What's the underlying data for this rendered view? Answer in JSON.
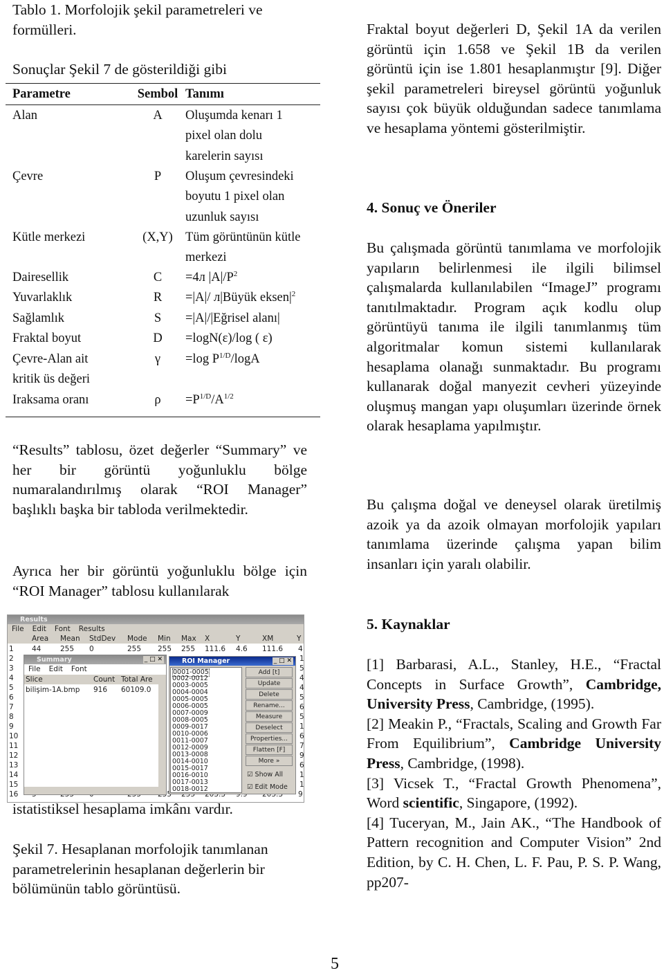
{
  "left": {
    "table_caption": [
      "Tablo 1. Morfolojik şekil parametreleri ve",
      "formülleri."
    ],
    "intro_line": "Sonuçlar Şekil 7 de gösterildiği gibi",
    "table": {
      "headers": [
        "Parametre",
        "Sembol",
        "Tanımı"
      ],
      "rows": [
        {
          "param": "Alan",
          "symbol": "A",
          "definition": [
            "Oluşumda kenarı 1",
            "pixel olan dolu",
            "karelerin sayısı"
          ]
        },
        {
          "param": "Çevre",
          "symbol": "P",
          "definition": [
            "Oluşum çevresindeki",
            "boyutu 1 pixel olan",
            "uzunluk sayısı"
          ]
        },
        {
          "param": "Kütle merkezi",
          "symbol": "(X,Y)",
          "definition": [
            "Tüm görüntünün kütle",
            "merkezi"
          ]
        },
        {
          "param": "Dairesellik",
          "symbol": "C",
          "formula": "=4л |A|/P",
          "sup": "2"
        },
        {
          "param": "Yuvarlaklık",
          "symbol": "R",
          "formula": "=|A|/ л|Büyük eksen|",
          "sup": "2"
        },
        {
          "param": "Sağlamlık",
          "symbol": "S",
          "formula": "=|A|/|Eğrisel alanı|"
        },
        {
          "param": "Fraktal boyut",
          "symbol": "D",
          "formula": "=logN(ε)/log ( ε)"
        },
        {
          "param": "Çevre-Alan ait",
          "param2": "kritik üs değeri",
          "symbol": "γ",
          "formula": "=log P",
          "sup": "1/D",
          "formula_tail": "/logA"
        },
        {
          "param": "Iraksama oranı",
          "symbol": "ρ",
          "formula": "=P",
          "sup": "1/D",
          "formula_mid": "/A",
          "sup2": "1/2"
        }
      ]
    },
    "para1": "“Results” tablosu, özet değerler “Summary” ve her bir görüntü yoğunluklu bölge numaralandırılmış olarak “ROI Manager” başlıklı başka bir tabloda verilmektedir.",
    "para2": "Ayrıca her bir görüntü yoğunluklu bölge için “ROI Manager” tablosu kullanılarak",
    "para3": "istatistiksel hesaplama imkânı vardır.",
    "figure_caption": "Şekil 7. Hesaplanan morfolojik tanımlanan parametrelerinin hesaplanan değerlerin bir bölümünün tablo görüntüsü.",
    "figure": {
      "results": {
        "title": "Results",
        "menu": [
          "File",
          "Edit",
          "Font",
          "Results"
        ],
        "columns": [
          "Area",
          "Mean",
          "StdDev",
          "Mode",
          "Min",
          "Max",
          "X",
          "Y",
          "XM",
          "Y"
        ],
        "row_numbers": [
          "1",
          "2",
          "3",
          "4",
          "5",
          "6",
          "7",
          "8",
          "9",
          "10",
          "11",
          "12",
          "13",
          "14",
          "15",
          "16"
        ],
        "row1": [
          "44",
          "255",
          "0",
          "255",
          "255",
          "255",
          "111.6",
          "4.6",
          "111.6",
          "4"
        ],
        "row16": [
          "5",
          "255",
          "0",
          "255",
          "255",
          "255",
          "203.3",
          "9.9",
          "203.3",
          "9"
        ],
        "right_edge": [
          "1",
          "5",
          "4",
          "4",
          "5",
          "6",
          "5",
          "1",
          "6",
          "7",
          "9",
          "6",
          "1",
          "1"
        ]
      },
      "summary": {
        "title": "Summary",
        "menu": [
          "File",
          "Edit",
          "Font"
        ],
        "columns": [
          "Slice",
          "Count",
          "Total Are"
        ],
        "row": [
          "bilişim-1A.bmp",
          "916",
          "60109.0"
        ]
      },
      "roi_manager": {
        "title": "ROI Manager",
        "items": [
          "0001-0005",
          "0002-0012",
          "0003-0005",
          "0004-0004",
          "0005-0005",
          "0006-0005",
          "0007-0009",
          "0008-0005",
          "0009-0017",
          "0010-0006",
          "0011-0007",
          "0012-0009",
          "0013-0008",
          "0014-0010",
          "0015-0017",
          "0016-0010",
          "0017-0013",
          "0018-0012"
        ],
        "buttons": [
          "Add [t]",
          "Update",
          "Delete",
          "Rename...",
          "Measure",
          "Deselect",
          "Properties...",
          "Flatten [F]",
          "More »"
        ],
        "checkboxes": [
          {
            "label": "Show All",
            "checked": true
          },
          {
            "label": "Edit Mode",
            "checked": true
          }
        ]
      }
    }
  },
  "right": {
    "para1": "Fraktal boyut değerleri D, Şekil 1A da verilen görüntü için 1.658 ve Şekil 1B da verilen görüntü için ise 1.801 hesaplanmıştır [9]. Diğer şekil parametreleri bireysel görüntü yoğunluk sayısı çok büyük olduğundan sadece tanımlama ve hesaplama yöntemi gösterilmiştir.",
    "heading4": "4. Sonuç ve Öneriler",
    "para2": "Bu çalışmada görüntü tanımlama ve morfolojik yapıların belirlenmesi ile ilgili bilimsel çalışmalarda kullanılabilen “ImageJ” programı tanıtılmaktadır. Program açık kodlu olup görüntüyü tanıma ile ilgili tanımlanmış tüm algoritmalar komun sistemi kullanılarak hesaplama olanağı sunmaktadır. Bu programı kullanarak doğal manyezit cevheri yüzeyinde oluşmuş mangan yapı oluşumları üzerinde örnek olarak hesaplama yapılmıştır.",
    "para3": "Bu çalışma doğal ve deneysel olarak üretilmiş azoik ya da azoik olmayan morfolojik yapıları tanımlama üzerinde çalışma yapan bilim insanları için yaralı olabilir.",
    "heading5": "5. Kaynaklar",
    "refs": [
      {
        "a": "[1] Barbarasi, A.L., Stanley, H.E., “Fractal Concepts in Surface Growth”, ",
        "b": "Cambridge, University Press",
        "c": ", Cambridge, (1995)."
      },
      {
        "a": "[2] Meakin P., “Fractals, Scaling and Growth Far From Equilibrium”, ",
        "b": "Cambridge University Press",
        "c": ", Cambridge, (1998)."
      },
      {
        "a": "[3] Vicsek T., “Fractal Growth Phenomena”, Word ",
        "b": "scientific",
        "c": ", Singapore, (1992)."
      },
      {
        "a": "[4] Tuceryan, M., Jain AK., “The Handbook of Pattern recognition and Computer Vision” 2nd Edition, by C. H. Chen, L. F. Pau, P. S. P. Wang, pp207-",
        "b": "",
        "c": ""
      }
    ]
  },
  "page_number": "5"
}
